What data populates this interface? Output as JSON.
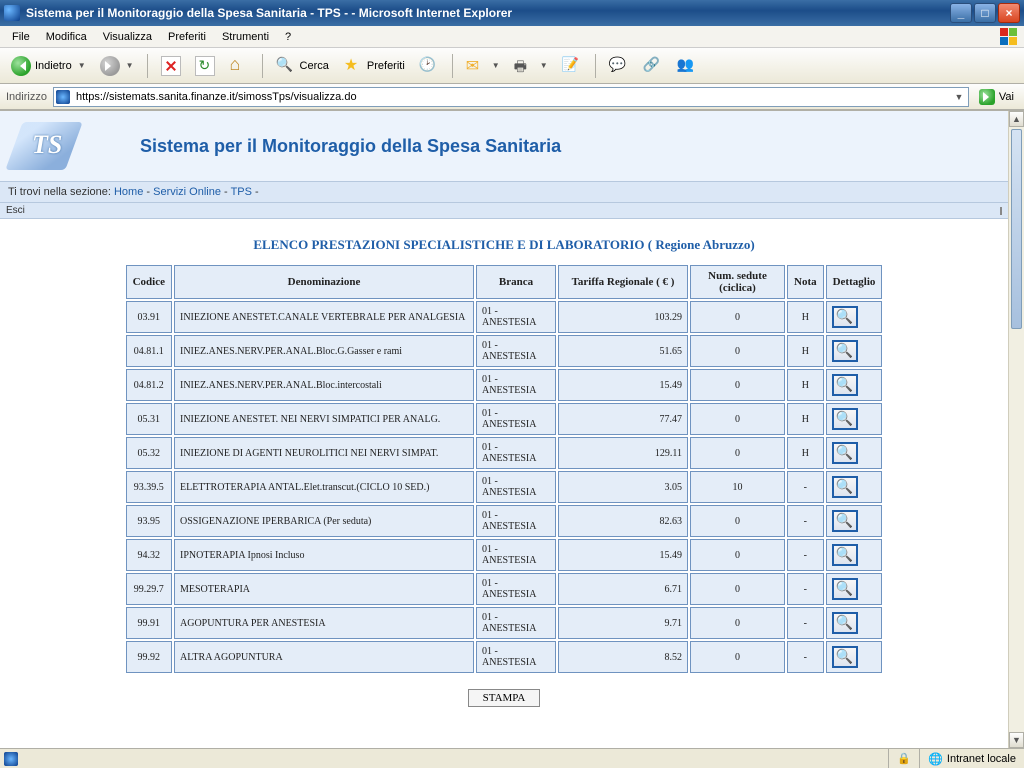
{
  "window": {
    "title": "Sistema per il Monitoraggio della Spesa Sanitaria - TPS - - Microsoft Internet Explorer"
  },
  "menu": {
    "file": "File",
    "modifica": "Modifica",
    "visualizza": "Visualizza",
    "preferiti": "Preferiti",
    "strumenti": "Strumenti",
    "help": "?"
  },
  "toolbar": {
    "back": "Indietro",
    "search": "Cerca",
    "favorites": "Preferiti"
  },
  "address": {
    "label": "Indirizzo",
    "url": "https://sistemats.sanita.finanze.it/simossTps/visualizza.do",
    "go": "Vai"
  },
  "page": {
    "site_title": "Sistema per il Monitoraggio della Spesa Sanitaria",
    "breadcrumb_prefix": "Ti trovi nella sezione: ",
    "bc_home": "Home",
    "bc_sep": " - ",
    "bc_serv": "Servizi Online",
    "bc_tps": "TPS",
    "esci": "Esci",
    "title": "ELENCO PRESTAZIONI SPECIALISTICHE E DI LABORATORIO ( Regione Abruzzo)",
    "stampa": "STAMPA"
  },
  "columns": {
    "codice": "Codice",
    "denominazione": "Denominazione",
    "branca": "Branca",
    "tariffa": "Tariffa Regionale ( € )",
    "sedute": "Num. sedute (ciclica)",
    "nota": "Nota",
    "dettaglio": "Dettaglio"
  },
  "rows": [
    {
      "codice": "03.91",
      "denom": "INIEZIONE ANESTET.CANALE VERTEBRALE PER ANALGESIA",
      "branca": "01 - ANESTESIA",
      "tariffa": "103.29",
      "sedute": "0",
      "nota": "H"
    },
    {
      "codice": "04.81.1",
      "denom": "INIEZ.ANES.NERV.PER.ANAL.Bloc.G.Gasser e rami",
      "branca": "01 - ANESTESIA",
      "tariffa": "51.65",
      "sedute": "0",
      "nota": "H"
    },
    {
      "codice": "04.81.2",
      "denom": "INIEZ.ANES.NERV.PER.ANAL.Bloc.intercostali",
      "branca": "01 - ANESTESIA",
      "tariffa": "15.49",
      "sedute": "0",
      "nota": "H"
    },
    {
      "codice": "05.31",
      "denom": "INIEZIONE ANESTET. NEI NERVI SIMPATICI PER ANALG.",
      "branca": "01 - ANESTESIA",
      "tariffa": "77.47",
      "sedute": "0",
      "nota": "H"
    },
    {
      "codice": "05.32",
      "denom": "INIEZIONE DI AGENTI NEUROLITICI NEI NERVI SIMPAT.",
      "branca": "01 - ANESTESIA",
      "tariffa": "129.11",
      "sedute": "0",
      "nota": "H"
    },
    {
      "codice": "93.39.5",
      "denom": "ELETTROTERAPIA ANTAL.Elet.transcut.(CICLO 10 SED.)",
      "branca": "01 - ANESTESIA",
      "tariffa": "3.05",
      "sedute": "10",
      "nota": "-"
    },
    {
      "codice": "93.95",
      "denom": "OSSIGENAZIONE IPERBARICA (Per seduta)",
      "branca": "01 - ANESTESIA",
      "tariffa": "82.63",
      "sedute": "0",
      "nota": "-"
    },
    {
      "codice": "94.32",
      "denom": "IPNOTERAPIA Ipnosi Incluso",
      "branca": "01 - ANESTESIA",
      "tariffa": "15.49",
      "sedute": "0",
      "nota": "-"
    },
    {
      "codice": "99.29.7",
      "denom": "MESOTERAPIA",
      "branca": "01 - ANESTESIA",
      "tariffa": "6.71",
      "sedute": "0",
      "nota": "-"
    },
    {
      "codice": "99.91",
      "denom": "AGOPUNTURA PER ANESTESIA",
      "branca": "01 - ANESTESIA",
      "tariffa": "9.71",
      "sedute": "0",
      "nota": "-"
    },
    {
      "codice": "99.92",
      "denom": "ALTRA AGOPUNTURA",
      "branca": "01 - ANESTESIA",
      "tariffa": "8.52",
      "sedute": "0",
      "nota": "-"
    }
  ],
  "status": {
    "zone": "Intranet locale"
  }
}
